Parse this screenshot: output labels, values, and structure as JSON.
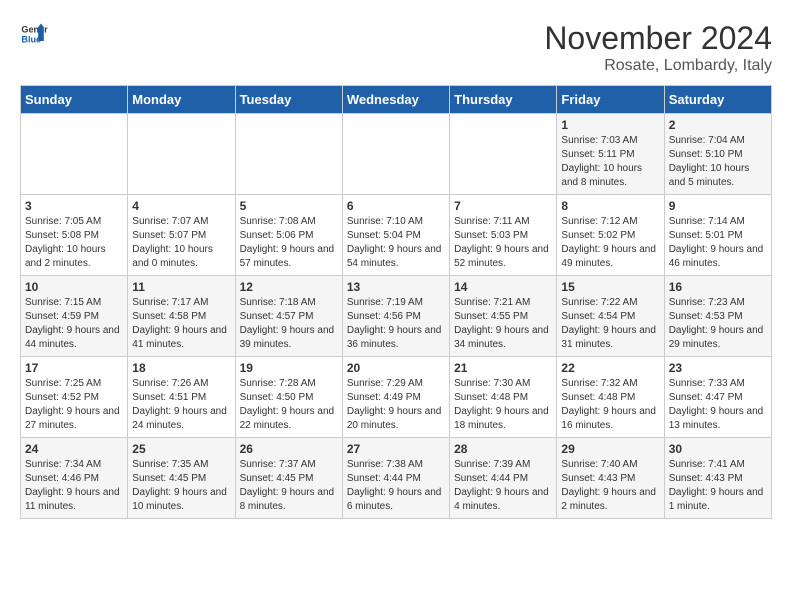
{
  "header": {
    "logo_general": "General",
    "logo_blue": "Blue",
    "month_title": "November 2024",
    "subtitle": "Rosate, Lombardy, Italy"
  },
  "weekdays": [
    "Sunday",
    "Monday",
    "Tuesday",
    "Wednesday",
    "Thursday",
    "Friday",
    "Saturday"
  ],
  "weeks": [
    [
      {
        "day": "",
        "info": ""
      },
      {
        "day": "",
        "info": ""
      },
      {
        "day": "",
        "info": ""
      },
      {
        "day": "",
        "info": ""
      },
      {
        "day": "",
        "info": ""
      },
      {
        "day": "1",
        "info": "Sunrise: 7:03 AM\nSunset: 5:11 PM\nDaylight: 10 hours and 8 minutes."
      },
      {
        "day": "2",
        "info": "Sunrise: 7:04 AM\nSunset: 5:10 PM\nDaylight: 10 hours and 5 minutes."
      }
    ],
    [
      {
        "day": "3",
        "info": "Sunrise: 7:05 AM\nSunset: 5:08 PM\nDaylight: 10 hours and 2 minutes."
      },
      {
        "day": "4",
        "info": "Sunrise: 7:07 AM\nSunset: 5:07 PM\nDaylight: 10 hours and 0 minutes."
      },
      {
        "day": "5",
        "info": "Sunrise: 7:08 AM\nSunset: 5:06 PM\nDaylight: 9 hours and 57 minutes."
      },
      {
        "day": "6",
        "info": "Sunrise: 7:10 AM\nSunset: 5:04 PM\nDaylight: 9 hours and 54 minutes."
      },
      {
        "day": "7",
        "info": "Sunrise: 7:11 AM\nSunset: 5:03 PM\nDaylight: 9 hours and 52 minutes."
      },
      {
        "day": "8",
        "info": "Sunrise: 7:12 AM\nSunset: 5:02 PM\nDaylight: 9 hours and 49 minutes."
      },
      {
        "day": "9",
        "info": "Sunrise: 7:14 AM\nSunset: 5:01 PM\nDaylight: 9 hours and 46 minutes."
      }
    ],
    [
      {
        "day": "10",
        "info": "Sunrise: 7:15 AM\nSunset: 4:59 PM\nDaylight: 9 hours and 44 minutes."
      },
      {
        "day": "11",
        "info": "Sunrise: 7:17 AM\nSunset: 4:58 PM\nDaylight: 9 hours and 41 minutes."
      },
      {
        "day": "12",
        "info": "Sunrise: 7:18 AM\nSunset: 4:57 PM\nDaylight: 9 hours and 39 minutes."
      },
      {
        "day": "13",
        "info": "Sunrise: 7:19 AM\nSunset: 4:56 PM\nDaylight: 9 hours and 36 minutes."
      },
      {
        "day": "14",
        "info": "Sunrise: 7:21 AM\nSunset: 4:55 PM\nDaylight: 9 hours and 34 minutes."
      },
      {
        "day": "15",
        "info": "Sunrise: 7:22 AM\nSunset: 4:54 PM\nDaylight: 9 hours and 31 minutes."
      },
      {
        "day": "16",
        "info": "Sunrise: 7:23 AM\nSunset: 4:53 PM\nDaylight: 9 hours and 29 minutes."
      }
    ],
    [
      {
        "day": "17",
        "info": "Sunrise: 7:25 AM\nSunset: 4:52 PM\nDaylight: 9 hours and 27 minutes."
      },
      {
        "day": "18",
        "info": "Sunrise: 7:26 AM\nSunset: 4:51 PM\nDaylight: 9 hours and 24 minutes."
      },
      {
        "day": "19",
        "info": "Sunrise: 7:28 AM\nSunset: 4:50 PM\nDaylight: 9 hours and 22 minutes."
      },
      {
        "day": "20",
        "info": "Sunrise: 7:29 AM\nSunset: 4:49 PM\nDaylight: 9 hours and 20 minutes."
      },
      {
        "day": "21",
        "info": "Sunrise: 7:30 AM\nSunset: 4:48 PM\nDaylight: 9 hours and 18 minutes."
      },
      {
        "day": "22",
        "info": "Sunrise: 7:32 AM\nSunset: 4:48 PM\nDaylight: 9 hours and 16 minutes."
      },
      {
        "day": "23",
        "info": "Sunrise: 7:33 AM\nSunset: 4:47 PM\nDaylight: 9 hours and 13 minutes."
      }
    ],
    [
      {
        "day": "24",
        "info": "Sunrise: 7:34 AM\nSunset: 4:46 PM\nDaylight: 9 hours and 11 minutes."
      },
      {
        "day": "25",
        "info": "Sunrise: 7:35 AM\nSunset: 4:45 PM\nDaylight: 9 hours and 10 minutes."
      },
      {
        "day": "26",
        "info": "Sunrise: 7:37 AM\nSunset: 4:45 PM\nDaylight: 9 hours and 8 minutes."
      },
      {
        "day": "27",
        "info": "Sunrise: 7:38 AM\nSunset: 4:44 PM\nDaylight: 9 hours and 6 minutes."
      },
      {
        "day": "28",
        "info": "Sunrise: 7:39 AM\nSunset: 4:44 PM\nDaylight: 9 hours and 4 minutes."
      },
      {
        "day": "29",
        "info": "Sunrise: 7:40 AM\nSunset: 4:43 PM\nDaylight: 9 hours and 2 minutes."
      },
      {
        "day": "30",
        "info": "Sunrise: 7:41 AM\nSunset: 4:43 PM\nDaylight: 9 hours and 1 minute."
      }
    ]
  ]
}
